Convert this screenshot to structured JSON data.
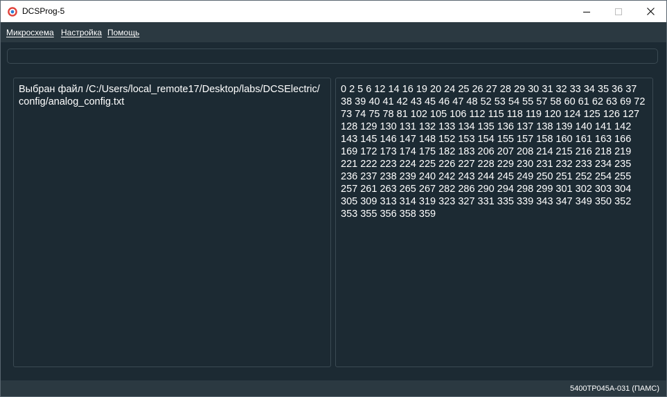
{
  "window": {
    "title": "DCSProg-5",
    "icon": "app-logo-icon",
    "controls": [
      "minimize-icon",
      "maximize-icon",
      "close-icon"
    ]
  },
  "menu": {
    "items": [
      "Микросхема",
      "Настройка",
      "Помощь"
    ]
  },
  "top_field": {
    "value": ""
  },
  "left_panel": {
    "text": "Выбран файл /C:/Users/local_remote17/Desktop/labs/DCSElectric/config/analog_config.txt"
  },
  "right_panel": {
    "text": "0 2 5 6 12 14 16 19 20 24 25 26 27 28 29 30 31 32 33 34 35 36 37 38 39 40 41 42 43 45 46 47 48 52 53 54 55 57 58 60 61 62 63 69 72 73 74 75 78 81 102 105 106 112 115 118 119 120 124 125 126 127 128 129 130 131 132 133 134 135 136 137 138 139 140 141 142 143 145 146 147 148 152 153 154 155 157 158 160 161 163 166 169 172 173 174 175 182 183 206 207 208 214 215 216 218 219 221 222 223 224 225 226 227 228 229 230 231 232 233 234 235 236 237 238 239 240 242 243 244 245 249 250 251 252 254 255 257 261 263 265 267 282 286 290 294 298 299 301 302 303 304 305 309 313 314 319 323 327 331 335 339 343 347 349 350 352 353 355 356 358 359"
  },
  "status": {
    "text": "5400ТР045А-031 (ПАМС)"
  },
  "colors": {
    "background": "#1c2a33",
    "bar": "#2b3941",
    "border": "#3b4a53",
    "text": "#ffffff",
    "titlebar": "#ffffff",
    "icon_red": "#e0413a",
    "icon_blue": "#2f7fd4"
  }
}
